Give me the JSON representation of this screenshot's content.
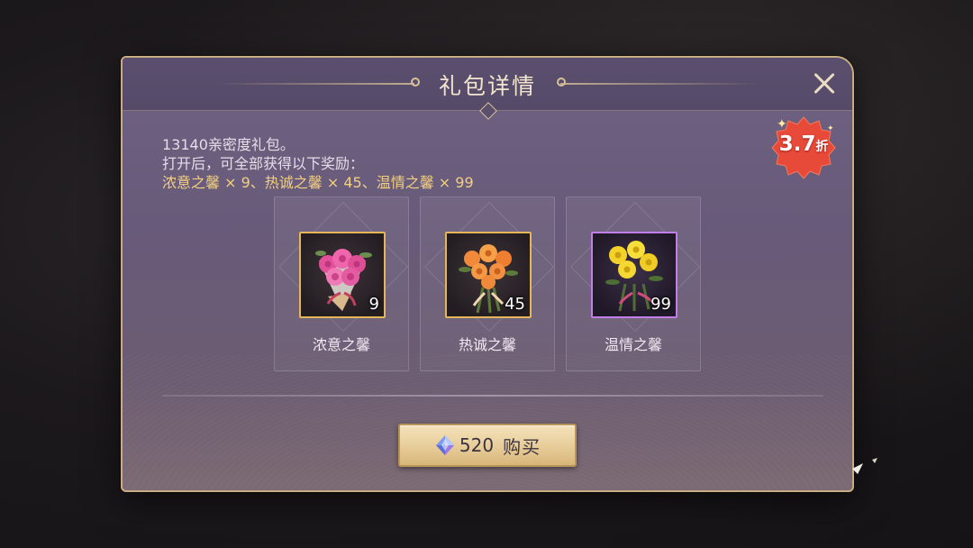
{
  "dialog": {
    "title": "礼包详情",
    "discount_badge": {
      "value": "3.7",
      "unit": "折",
      "color": "#e84a3a"
    },
    "description": {
      "line1": "13140亲密度礼包。",
      "line2": "打开后，可全部获得以下奖励：",
      "line3": "浓意之馨 × 9、热诚之馨 × 45、温情之馨 × 99"
    },
    "rewards": [
      {
        "name": "浓意之馨",
        "count": "9",
        "flower": "pink-rose-bouquet-icon",
        "frame_color": "#e5b55a"
      },
      {
        "name": "热诚之馨",
        "count": "45",
        "flower": "orange-rose-bouquet-icon",
        "frame_color": "#e5b55a"
      },
      {
        "name": "温情之馨",
        "count": "99",
        "flower": "yellow-rose-bouquet-icon",
        "frame_color": "#c27ee8"
      }
    ],
    "buy_button": {
      "price": "520",
      "label": "购买",
      "currency_icon": "diamond-gem-icon"
    }
  }
}
